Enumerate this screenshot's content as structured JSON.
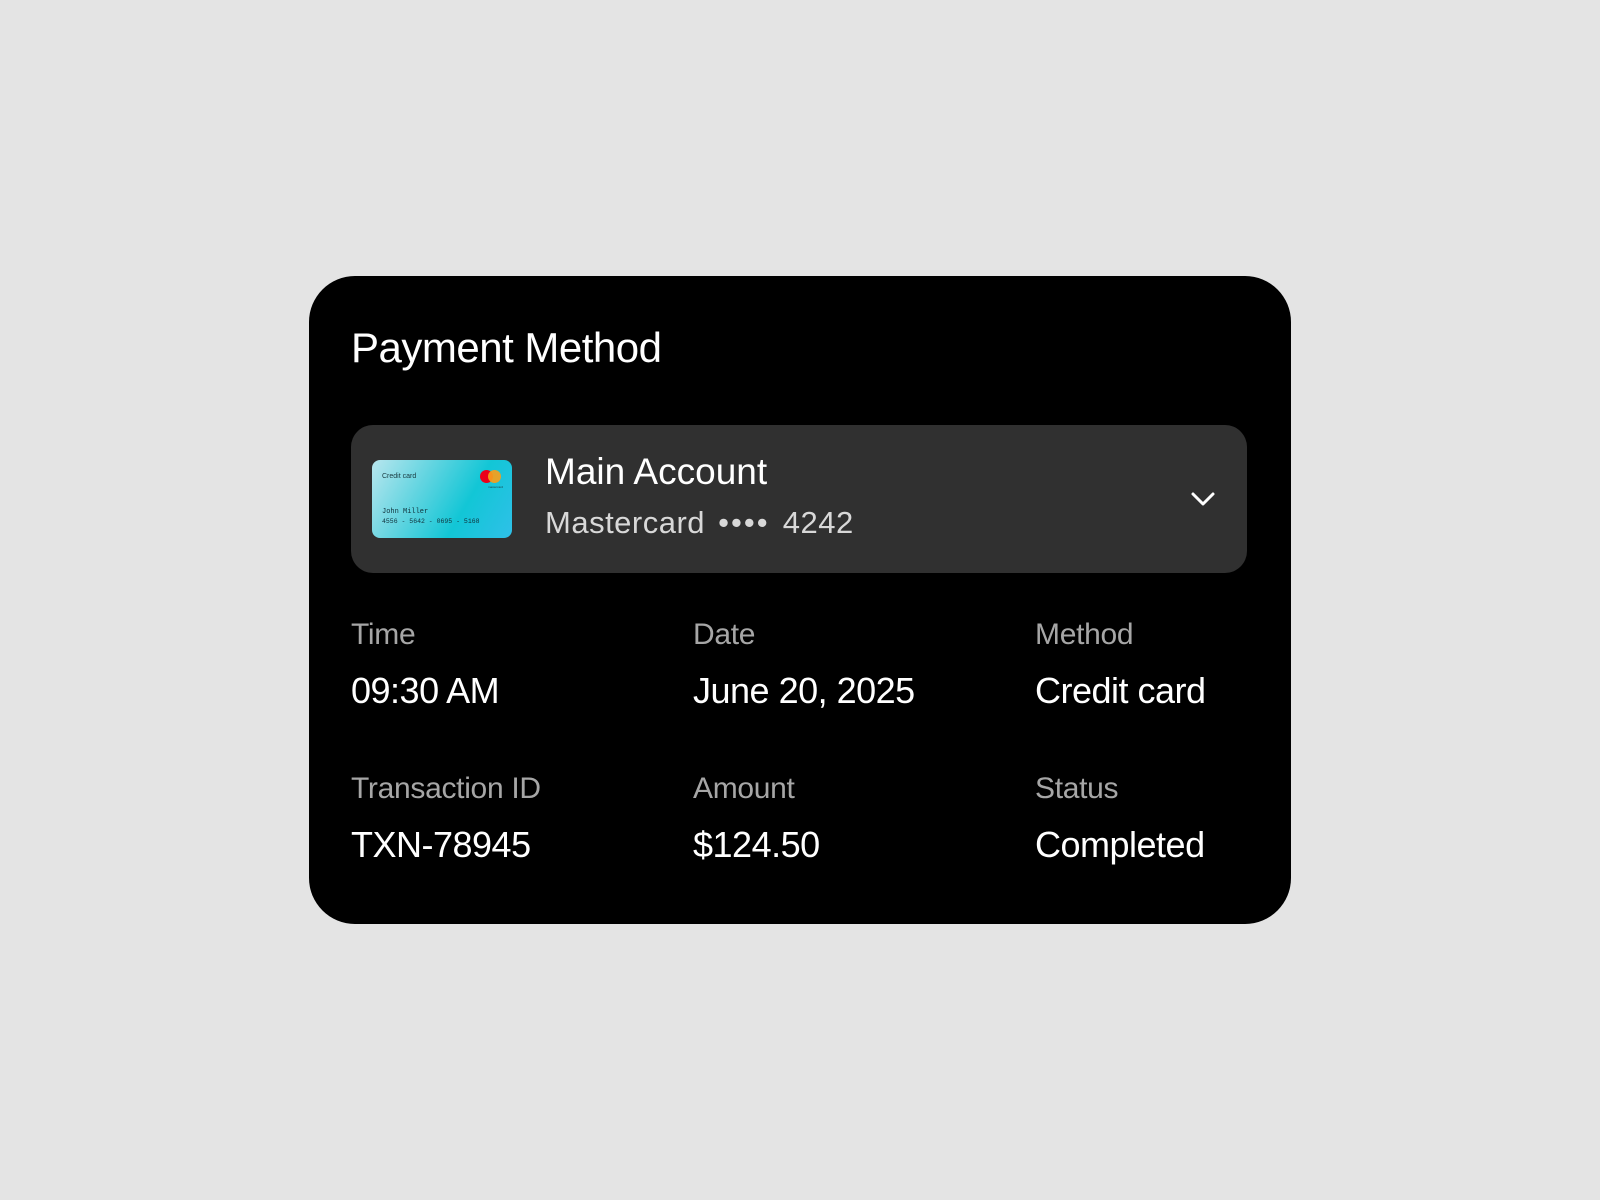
{
  "panel": {
    "title": "Payment Method"
  },
  "account_selector": {
    "name": "Main Account",
    "brand": "Mastercard",
    "masked": "••••",
    "last4": "4242",
    "icon": "chevron-down-icon",
    "card_preview": {
      "type_label": "Credit card",
      "brand_mark": "mastercard",
      "holder": "John Miller",
      "number": "4556 - 5642 - 0695 - 5168"
    }
  },
  "details": [
    {
      "label": "Time",
      "value": "09:30 AM"
    },
    {
      "label": "Date",
      "value": "June 20, 2025"
    },
    {
      "label": "Method",
      "value": "Credit card"
    },
    {
      "label": "Transaction ID",
      "value": "TXN-78945"
    },
    {
      "label": "Amount",
      "value": "$124.50"
    },
    {
      "label": "Status",
      "value": "Completed"
    }
  ],
  "colors": {
    "background": "#e4e4e4",
    "panel": "#000000",
    "selector": "#303030",
    "label": "#a6a6a6",
    "value": "#ffffff"
  }
}
